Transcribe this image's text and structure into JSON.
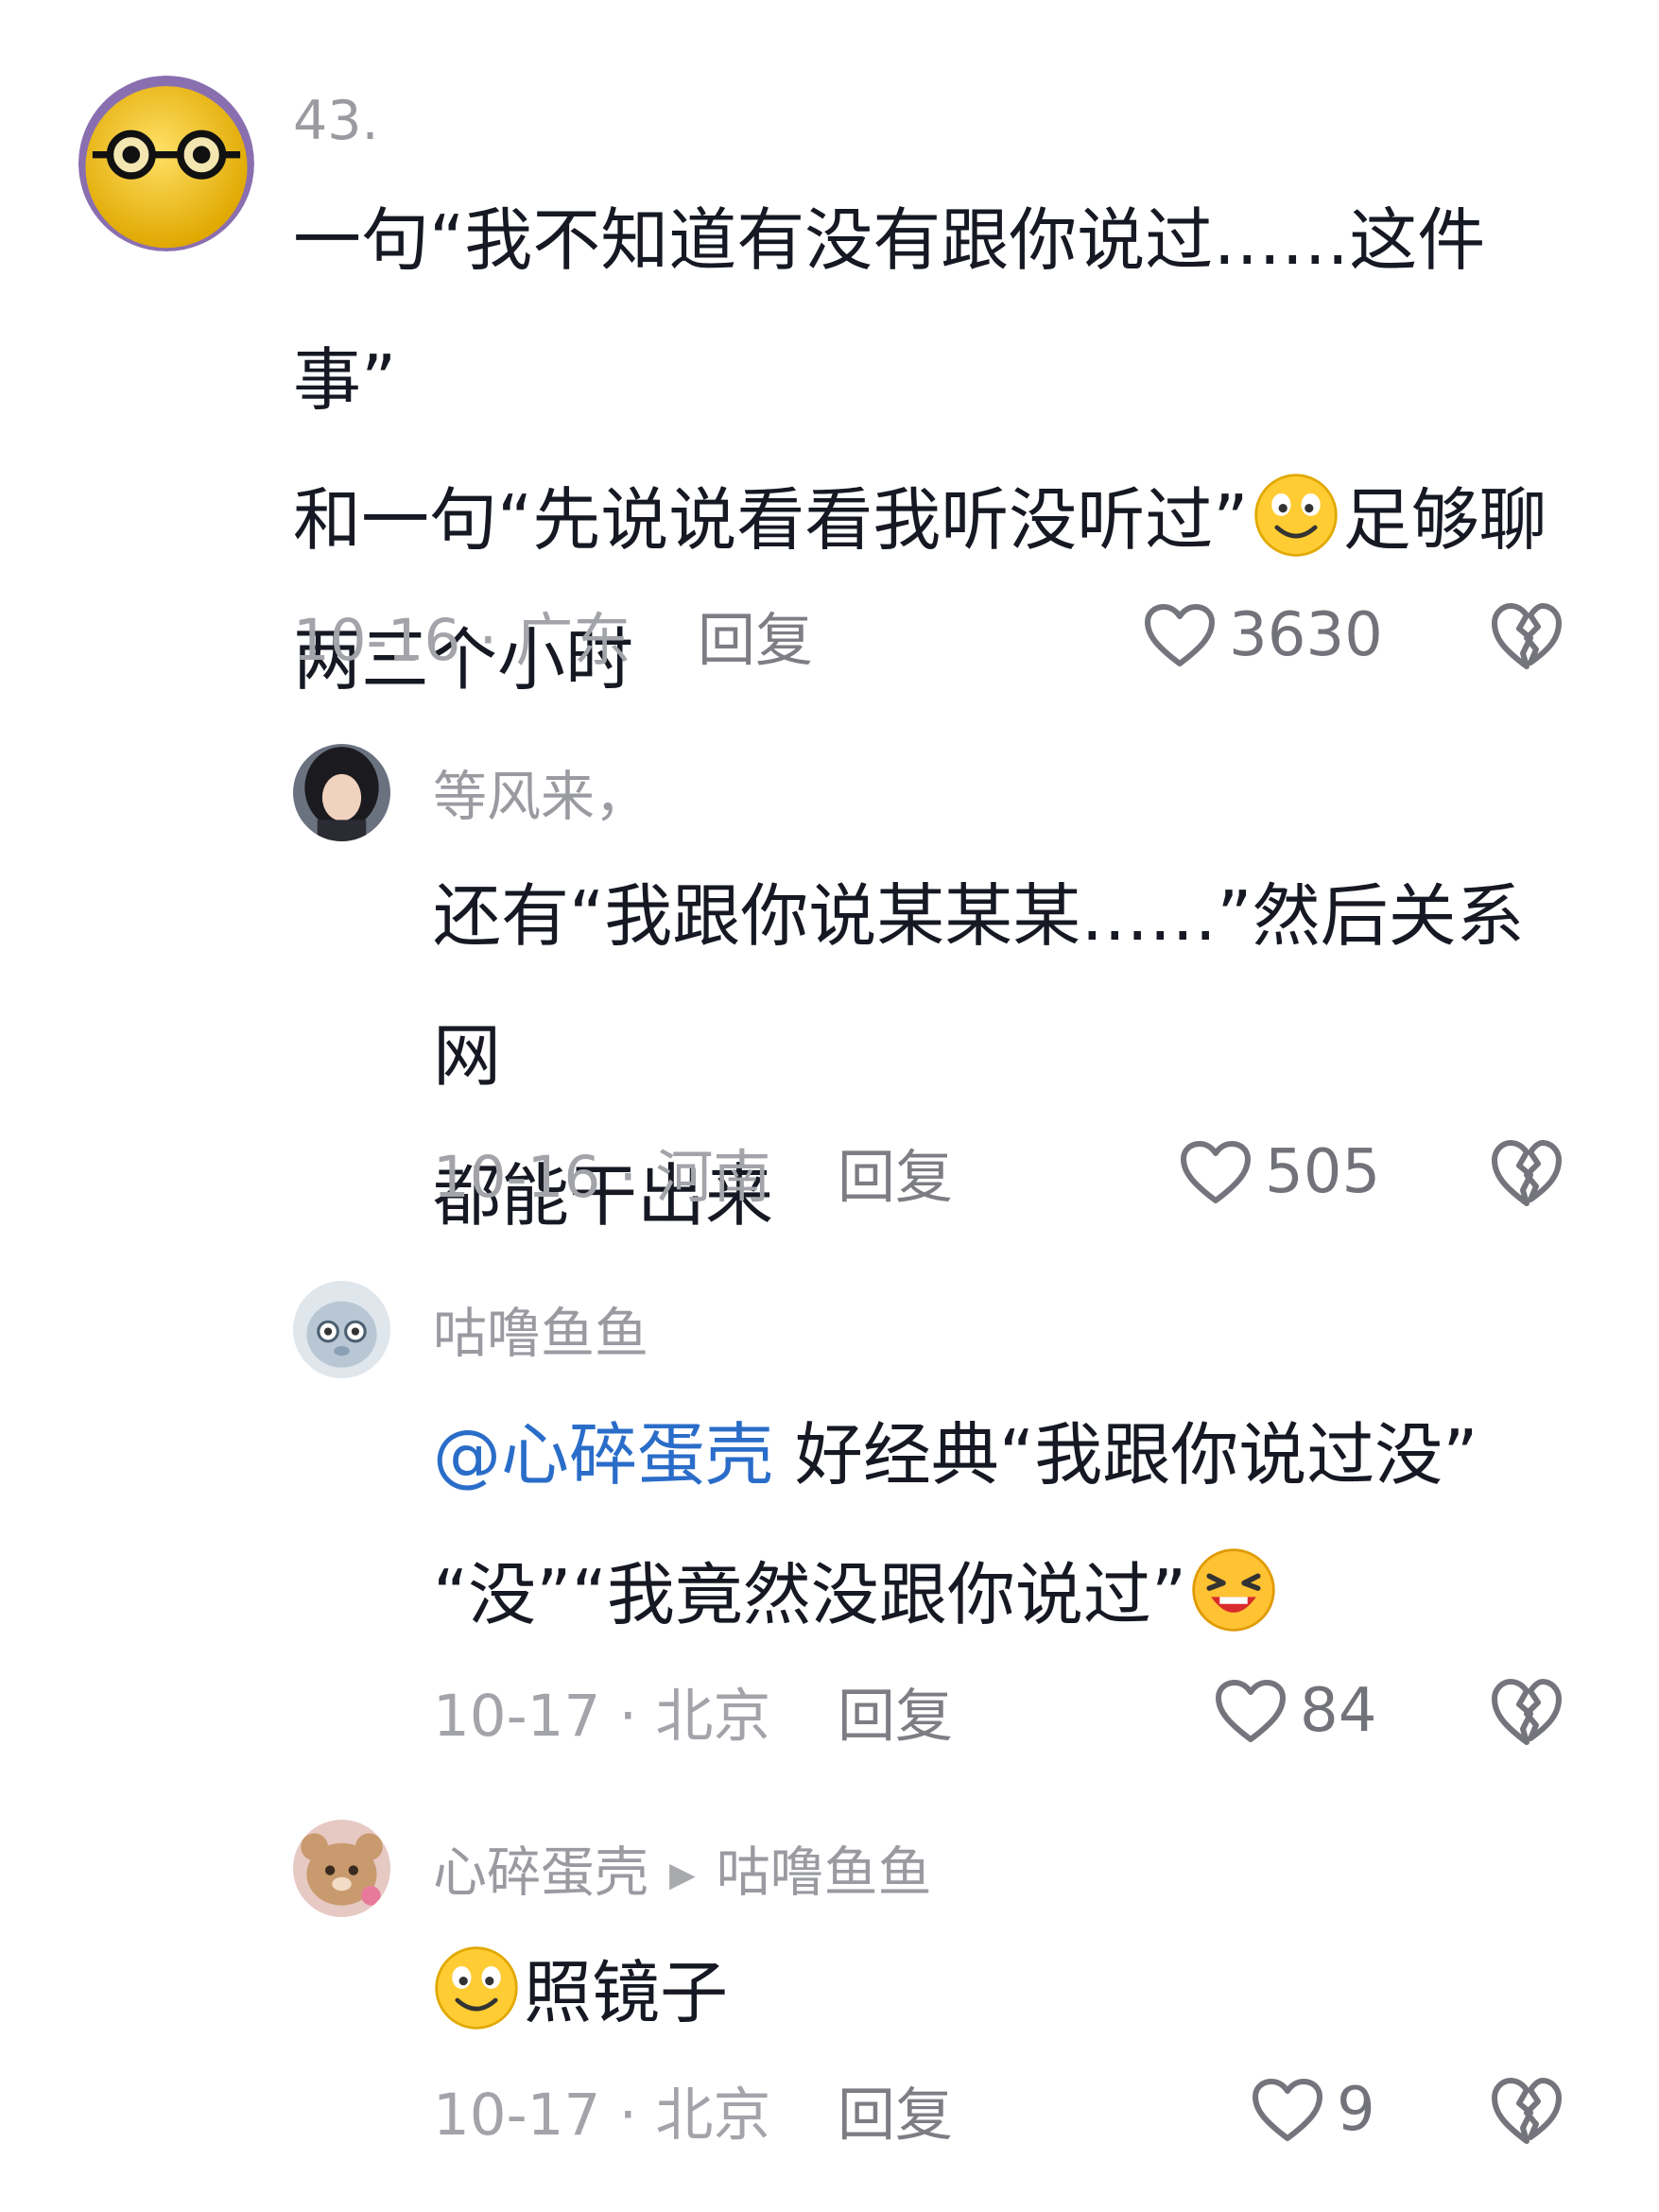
{
  "comments": [
    {
      "username": "43.",
      "text_line1": "一句“我不知道有没有跟你说过……这件事”",
      "text_line2a": "和一句“先说说看看我听没听过”",
      "text_line2b": "足够聊",
      "text_line3": "两三个小时",
      "meta": "10-16 · 广东",
      "reply_label": "回复",
      "likes": "3630"
    },
    {
      "username": "等风来，",
      "text_line1": "还有“我跟你说某某某……”然后关系网",
      "text_line2": "都能干出来",
      "meta": "10-16 · 河南",
      "reply_label": "回复",
      "likes": "505"
    },
    {
      "username": "咕噜鱼鱼",
      "mention": "@心碎蛋壳",
      "text_line1": " 好经典“我跟你说过没”",
      "text_line2": "“没”“我竟然没跟你说过”",
      "meta": "10-17 · 北京",
      "reply_label": "回复",
      "likes": "84"
    },
    {
      "username": "心碎蛋壳",
      "reply_to": "咕噜鱼鱼",
      "text": "照镜子",
      "meta": "10-17 · 北京",
      "reply_label": "回复",
      "likes": "9"
    }
  ],
  "icons": {
    "like": "heart-outline-icon",
    "dislike": "broken-heart-icon",
    "emoji_smile": "smile-emoji-icon",
    "emoji_laugh": "laughing-emoji-icon",
    "reply_arrow": "play-arrow-icon"
  },
  "colors": {
    "mention": "#2a6dc9",
    "meta": "#a3a4aa",
    "text": "#161823"
  }
}
